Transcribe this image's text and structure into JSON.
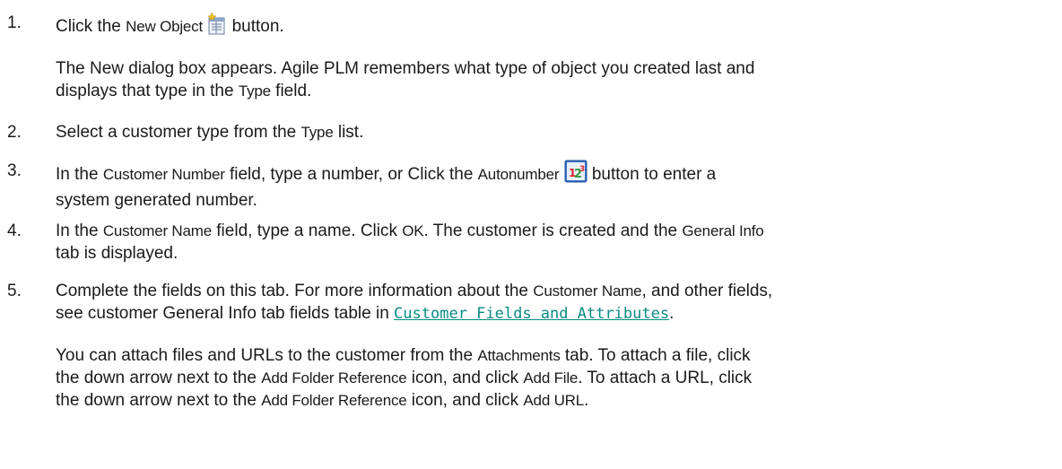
{
  "steps": [
    {
      "num": "1.",
      "pre": "Click the ",
      "ui": "New Object",
      "icon": "new-object-icon",
      "post": " button."
    },
    {
      "num": "2.",
      "pre": "Select a customer type from the ",
      "ui": "Type",
      "post": " list."
    },
    {
      "num": "3.",
      "pre": "In the ",
      "ui1": "Customer Number",
      "mid": " field, type a number, or Click the ",
      "ui2": "Autonumber",
      "icon": "autonumber-icon",
      "post1": " button to enter a",
      "line2": "system generated number."
    },
    {
      "num": "4.",
      "pre": "In the ",
      "ui1": "Customer Name",
      "mid1": " field, type a name. Click ",
      "ui2": "OK",
      "mid2": ". The customer is created and the ",
      "ui3": "General Info",
      "line2": "tab is displayed."
    },
    {
      "num": "5.",
      "pre": "Complete the fields on this tab. For more information about the ",
      "ui1": "Customer Name",
      "post1": ", and other fields,",
      "line2pre": "see customer General Info tab fields table in ",
      "link": "Customer Fields and Attributes",
      "line2post": "."
    }
  ],
  "para1": {
    "line1": "The New dialog box appears. Agile PLM remembers what type of object you created last and",
    "line2pre": "displays that type in the ",
    "ui": "Type",
    "line2post": " field."
  },
  "para2": {
    "l1pre": "You can attach files and URLs to the customer from the ",
    "l1ui": "Attachments",
    "l1post": " tab. To attach a file, click",
    "l2pre": "the down arrow next to the ",
    "l2ui1": "Add Folder Reference",
    "l2mid": " icon, and click ",
    "l2ui2": "Add File",
    "l2post": ". To attach a URL, click",
    "l3pre": "the down arrow next to the ",
    "l3ui1": "Add Folder Reference",
    "l3mid": " icon, and click ",
    "l3ui2": "Add URL",
    "l3post": "."
  },
  "colors": {
    "text": "#1a1a1a",
    "link": "#0b8a82"
  }
}
